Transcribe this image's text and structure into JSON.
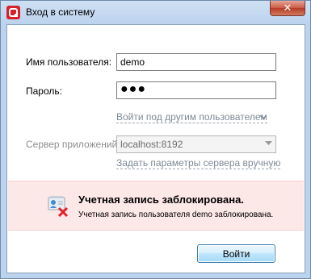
{
  "window": {
    "title": "Вход в систему",
    "close_glyph": "✕",
    "icon": "app-logo-icon"
  },
  "form": {
    "username_label": "Имя пользователя:",
    "username_value": "demo",
    "password_label": "Пароль:",
    "password_value": "●●●",
    "other_user_link": "Войти под другим пользователем",
    "server_label": "Сервер приложений:",
    "server_value": "localhost:8192",
    "server_params_link": "Задать параметры сервера вручную"
  },
  "error": {
    "title": "Учетная запись заблокирована.",
    "message": "Учетная запись пользователя demo заблокирована.",
    "icon": "locked-account-icon",
    "background": "#fde8e8"
  },
  "actions": {
    "login_label": "Войти"
  },
  "colors": {
    "accent": "#d6202a",
    "link": "#7d8a96"
  }
}
